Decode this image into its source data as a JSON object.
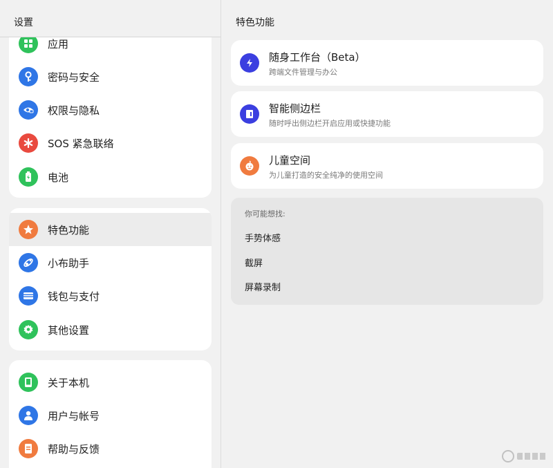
{
  "left": {
    "title": "设置",
    "group1": [
      {
        "label": "应用",
        "icon": "apps-grid-icon",
        "color": "#2fc25b"
      },
      {
        "label": "密码与安全",
        "icon": "key-icon",
        "color": "#2f76e6"
      },
      {
        "label": "权限与隐私",
        "icon": "eye-lock-icon",
        "color": "#2f76e6"
      },
      {
        "label": "SOS 紧急联络",
        "icon": "asterisk-icon",
        "color": "#e94a3f"
      },
      {
        "label": "电池",
        "icon": "battery-icon",
        "color": "#2fc25b"
      }
    ],
    "group2": [
      {
        "label": "特色功能",
        "icon": "star-icon",
        "color": "#f07b3f",
        "active": true
      },
      {
        "label": "小布助手",
        "icon": "breeno-icon",
        "color": "#2f76e6"
      },
      {
        "label": "钱包与支付",
        "icon": "wallet-icon",
        "color": "#2f76e6"
      },
      {
        "label": "其他设置",
        "icon": "gear-icon",
        "color": "#2fc25b"
      }
    ],
    "group3": [
      {
        "label": "关于本机",
        "icon": "phone-icon",
        "color": "#2fc25b"
      },
      {
        "label": "用户与帐号",
        "icon": "user-icon",
        "color": "#2f76e6"
      },
      {
        "label": "帮助与反馈",
        "icon": "help-doc-icon",
        "color": "#f07b3f"
      }
    ]
  },
  "right": {
    "title": "特色功能",
    "cards": [
      {
        "title": "随身工作台（Beta）",
        "subtitle": "跨端文件管理与办公",
        "icon": "workbench-icon",
        "color": "#3b3fe0"
      },
      {
        "title": "智能侧边栏",
        "subtitle": "随时呼出侧边栏开启应用或快捷功能",
        "icon": "sidebar-icon",
        "color": "#3b3fe0"
      },
      {
        "title": "儿童空间",
        "subtitle": "为儿童打造的安全纯净的使用空间",
        "icon": "kid-face-icon",
        "color": "#f07b3f"
      }
    ],
    "suggest": {
      "title": "你可能想找:",
      "links": [
        "手势体感",
        "截屏",
        "屏幕录制"
      ]
    }
  }
}
